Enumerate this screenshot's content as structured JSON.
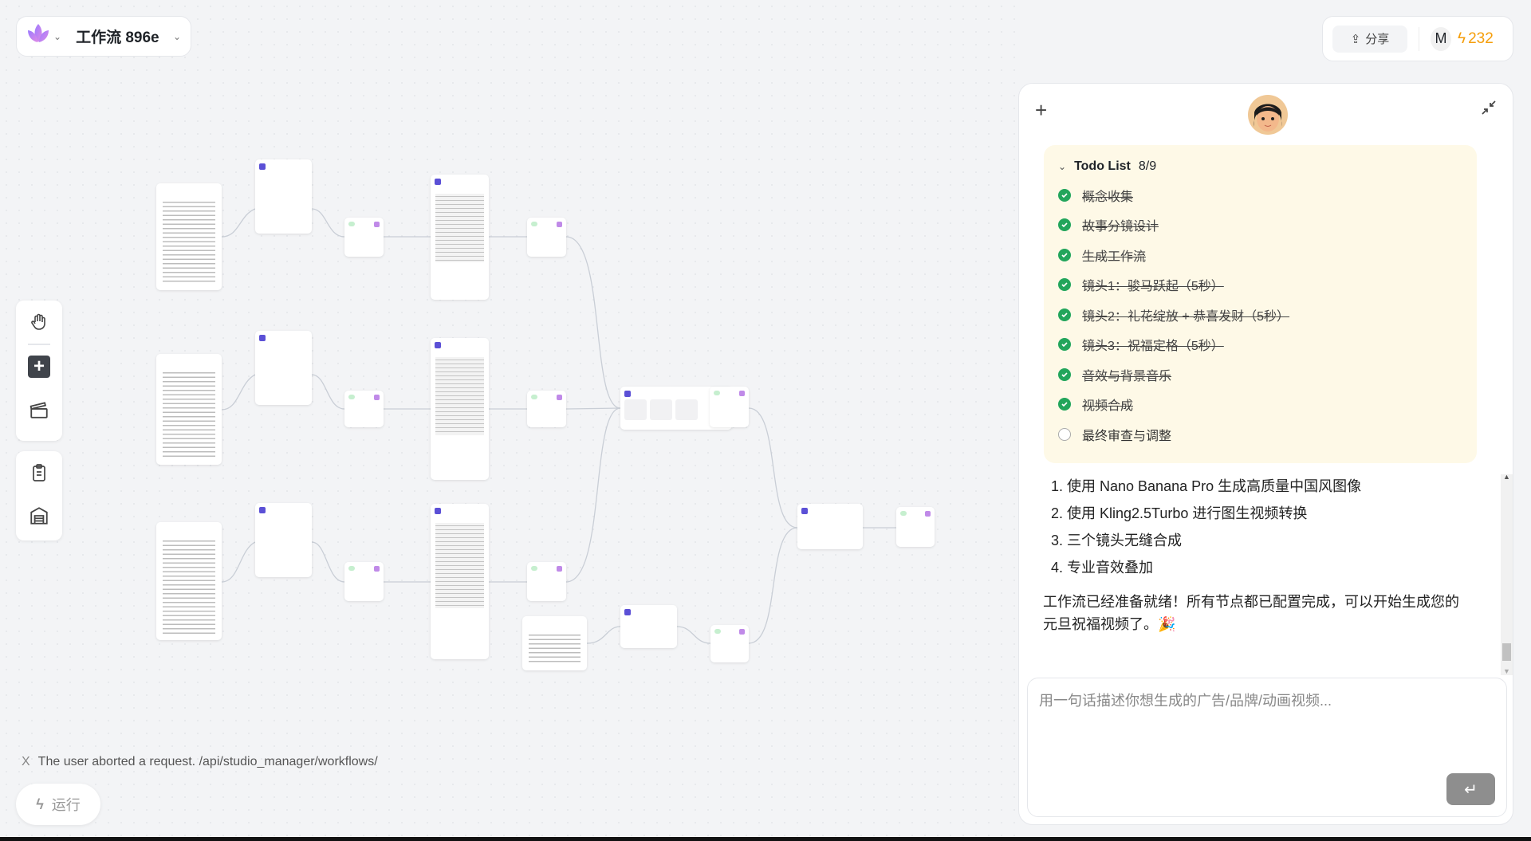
{
  "header": {
    "title": "工作流 896e",
    "share_label": "分享",
    "user_initial": "M",
    "credits": "232"
  },
  "canvas": {
    "error_text": "The user aborted a request. /api/studio_manager/workflows/",
    "error_icon": "X",
    "run_label": "运行"
  },
  "chat": {
    "todo": {
      "title": "Todo List",
      "count": "8/9",
      "items": [
        {
          "label": "概念收集",
          "done": true
        },
        {
          "label": "故事分镜设计",
          "done": true
        },
        {
          "label": "生成工作流",
          "done": true
        },
        {
          "label": "镜头1：骏马跃起（5秒）",
          "done": true
        },
        {
          "label": "镜头2：礼花绽放 + 恭喜发财（5秒）",
          "done": true
        },
        {
          "label": "镜头3：祝福定格（5秒）",
          "done": true
        },
        {
          "label": "音效与背景音乐",
          "done": true
        },
        {
          "label": "视频合成",
          "done": true
        },
        {
          "label": "最终审查与调整",
          "done": false
        }
      ]
    },
    "steps": [
      "1. 使用 Nano Banana Pro 生成高质量中国风图像",
      "2. 使用 Kling2.5Turbo 进行图生视频转换",
      "3. 三个镜头无缝合成",
      "4. 专业音效叠加"
    ],
    "message": "工作流已经准备就绪！所有节点都已配置完成，可以开始生成您的元旦祝福视频了。🎉",
    "input_placeholder": "用一句话描述你想生成的广告/品牌/动画视频...",
    "send_icon": "↵"
  },
  "colors": {
    "accent": "#5b50d6",
    "credits": "#f59e0b",
    "done": "#22a55b",
    "todo_bg": "#fef9e7"
  }
}
